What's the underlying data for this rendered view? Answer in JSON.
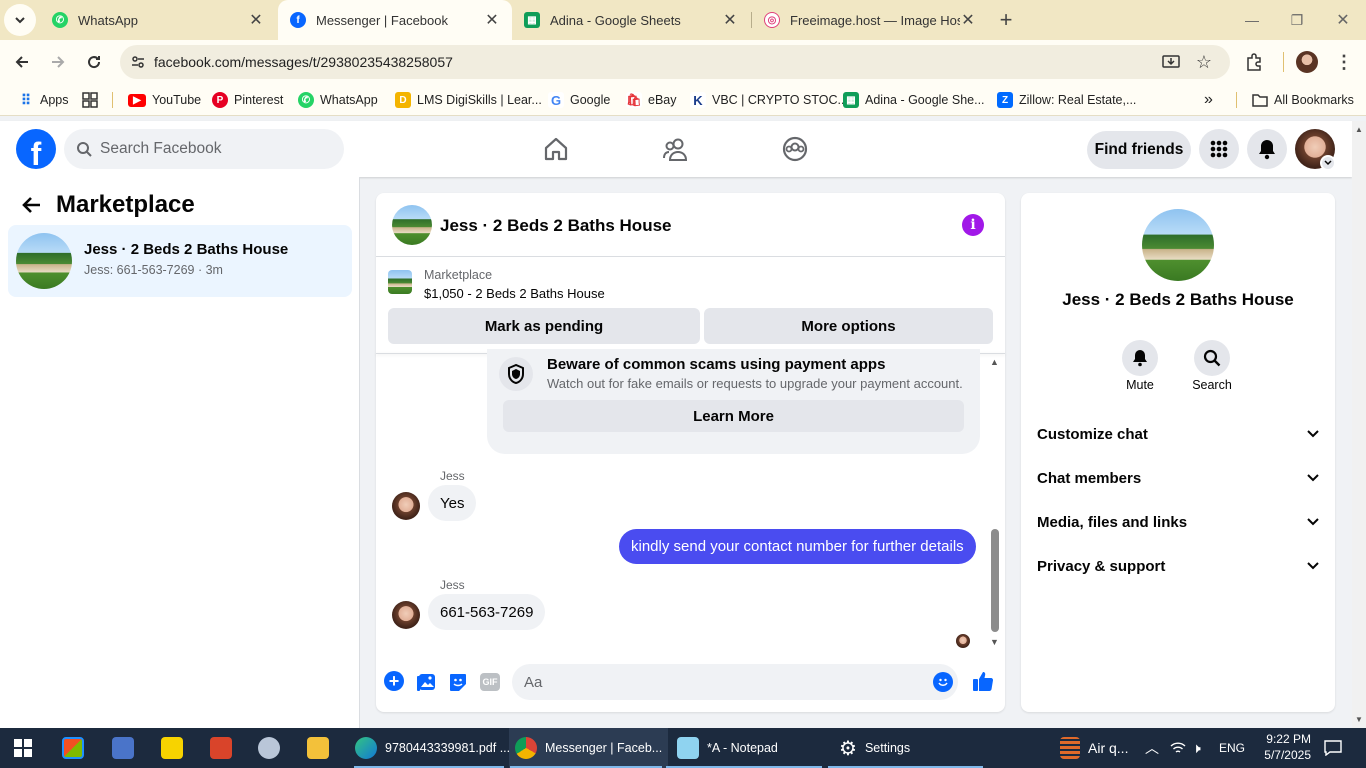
{
  "browser": {
    "tabs": [
      {
        "title": "WhatsApp",
        "icon": "whatsapp-icon",
        "color": "#25d366"
      },
      {
        "title": "Messenger | Facebook",
        "icon": "facebook-icon",
        "color": "#0866ff"
      },
      {
        "title": "Adina - Google Sheets",
        "icon": "sheets-icon",
        "color": "#0f9d58"
      },
      {
        "title": "Freeimage.host — Image Hostin",
        "icon": "freeimage-icon",
        "color": "#e0417b"
      }
    ],
    "url": "facebook.com/messages/t/29380235438258057",
    "bookmarks": [
      {
        "label": "Apps",
        "icon": "apps-grid-icon"
      },
      {
        "label": "YouTube",
        "icon": "youtube-icon",
        "color": "#ff0000"
      },
      {
        "label": "Pinterest",
        "icon": "pinterest-icon",
        "color": "#e60023"
      },
      {
        "label": "WhatsApp",
        "icon": "whatsapp-icon",
        "color": "#25d366"
      },
      {
        "label": "LMS DigiSkills | Lear...",
        "icon": "digiskills-icon",
        "color": "#f4b400"
      },
      {
        "label": "Google",
        "icon": "google-icon",
        "color": "#4285f4"
      },
      {
        "label": "eBay",
        "icon": "ebay-icon",
        "color": "#e53238"
      },
      {
        "label": "VBC | CRYPTO STOC...",
        "icon": "vbc-icon",
        "color": "#1a3c8c"
      },
      {
        "label": "Adina - Google She...",
        "icon": "sheets-icon",
        "color": "#0f9d58"
      },
      {
        "label": "Zillow: Real Estate,...",
        "icon": "zillow-icon",
        "color": "#006aff"
      }
    ],
    "all_bookmarks": "All Bookmarks"
  },
  "fb": {
    "search_placeholder": "Search Facebook",
    "find_friends": "Find friends"
  },
  "left": {
    "title": "Marketplace",
    "chat_item": {
      "name": "Jess · 2 Beds 2 Baths House",
      "preview": "Jess: 661-563-7269 · 3m"
    }
  },
  "chat": {
    "header_name": "Jess · 2 Beds 2 Baths House",
    "listing_label": "Marketplace",
    "listing_price_title": "$1,050 - 2 Beds 2 Baths House",
    "mark_pending": "Mark as pending",
    "more_options": "More options",
    "scam_title": "Beware of common scams using payment apps",
    "scam_body": "Watch out for fake emails or requests to upgrade your payment account.",
    "learn_more": "Learn More",
    "messages": [
      {
        "sender": "Jess",
        "text": "Yes",
        "outgoing": false
      },
      {
        "sender": "",
        "text": "kindly send your contact number for further details",
        "outgoing": true
      },
      {
        "sender": "Jess",
        "text": "661-563-7269",
        "outgoing": false
      }
    ],
    "composer_placeholder": "Aa",
    "accent": "#4a4cf0"
  },
  "right": {
    "name": "Jess · 2 Beds 2 Baths House",
    "mute": "Mute",
    "search": "Search",
    "sections": [
      "Customize chat",
      "Chat members",
      "Media, files and links",
      "Privacy & support"
    ]
  },
  "taskbar": {
    "apps": [
      {
        "label": "9780443339981.pdf ...",
        "icon": "edge-icon"
      },
      {
        "label": "Messenger | Faceb...",
        "icon": "chrome-icon"
      },
      {
        "label": "*A - Notepad",
        "icon": "notepad-icon"
      },
      {
        "label": "Settings",
        "icon": "settings-icon"
      }
    ],
    "weather": "Air q...",
    "lang": "ENG",
    "time": "9:22 PM",
    "date": "5/7/2025"
  }
}
